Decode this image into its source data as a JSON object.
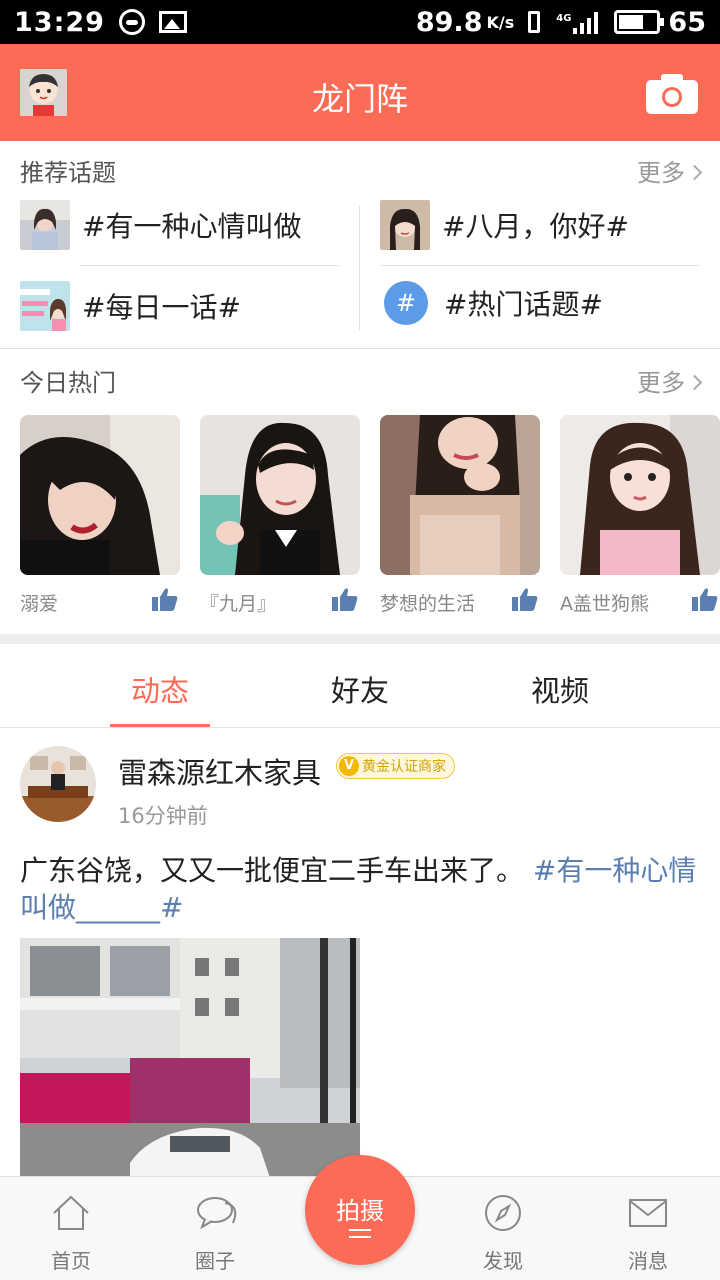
{
  "status_bar": {
    "time": "13:29",
    "net_speed": "89.8",
    "net_unit": "K/s",
    "signal_tag": "4G",
    "battery": "65"
  },
  "header": {
    "title": "龙门阵"
  },
  "recommended": {
    "title": "推荐话题",
    "more": "更多",
    "topics": [
      {
        "label": "#有一种心情叫做"
      },
      {
        "label": "#八月，你好#"
      },
      {
        "label": "#每日一话#"
      },
      {
        "label": "#热门话题#"
      }
    ],
    "hash_glyph": "#"
  },
  "today_hot": {
    "title": "今日热门",
    "more": "更多",
    "items": [
      {
        "name": "溺爱"
      },
      {
        "name": "『九月』"
      },
      {
        "name": "梦想的生活"
      },
      {
        "name": "A盖世狗熊"
      }
    ]
  },
  "feed_tabs": [
    {
      "label": "动态",
      "active": true
    },
    {
      "label": "好友",
      "active": false
    },
    {
      "label": "视频",
      "active": false
    }
  ],
  "post": {
    "author": "雷森源红木家具",
    "badge_mark": "V",
    "badge": "黄金认证商家",
    "time": "16分钟前",
    "text": "广东谷饶，又又一批便宜二手车出来了。",
    "tag": "#有一种心情叫做______#"
  },
  "bottom_nav": {
    "items": [
      {
        "label": "首页",
        "icon": "home-icon"
      },
      {
        "label": "圈子",
        "icon": "chat-bubble-icon"
      },
      {
        "label": "发现",
        "icon": "compass-icon"
      },
      {
        "label": "消息",
        "icon": "mail-icon"
      }
    ],
    "shoot": "拍摄"
  },
  "colors": {
    "accent": "#fb6b55",
    "tag_blue": "#5b7fb0",
    "hash_circle": "#5b9be8",
    "badge_gold": "#f5b800"
  }
}
